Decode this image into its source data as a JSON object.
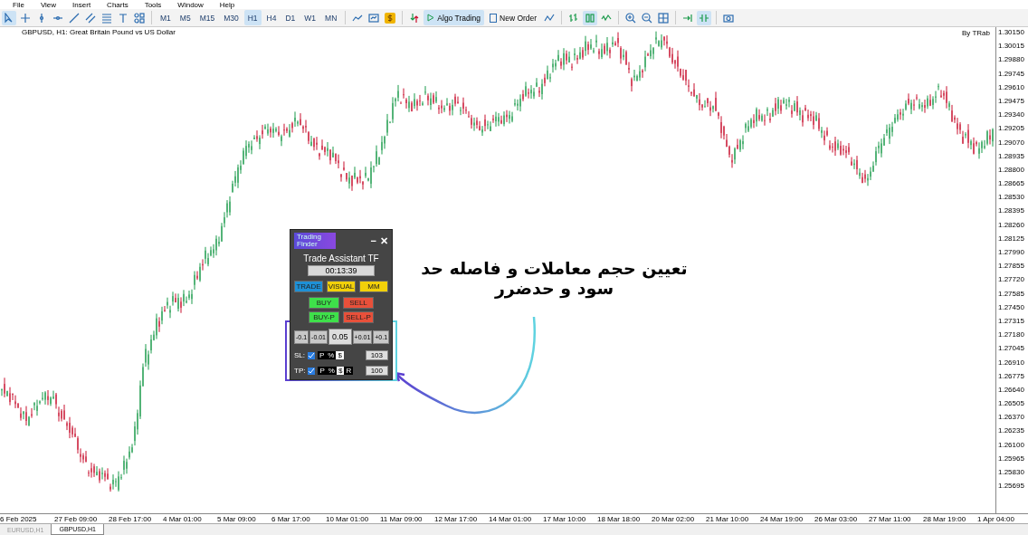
{
  "menu": [
    "File",
    "View",
    "Insert",
    "Charts",
    "Tools",
    "Window",
    "Help"
  ],
  "toolbar": {
    "timeframes": [
      {
        "label": "M1",
        "selected": false
      },
      {
        "label": "M5",
        "selected": false
      },
      {
        "label": "M15",
        "selected": false
      },
      {
        "label": "M30",
        "selected": false
      },
      {
        "label": "H1",
        "selected": true
      },
      {
        "label": "H4",
        "selected": false
      },
      {
        "label": "D1",
        "selected": false
      },
      {
        "label": "W1",
        "selected": false
      },
      {
        "label": "MN",
        "selected": false
      }
    ],
    "algo_trading": {
      "label": "Algo Trading",
      "selected": true
    },
    "new_order": {
      "label": "New Order"
    }
  },
  "chart": {
    "title": "GBPUSD, H1:  Great Britain Pound vs US Dollar",
    "author": "By TRab",
    "price_labels": [
      "1.30150",
      "1.30015",
      "1.29880",
      "1.29745",
      "1.29610",
      "1.29475",
      "1.29340",
      "1.29205",
      "1.29070",
      "1.28935",
      "1.28800",
      "1.28665",
      "1.28530",
      "1.28395",
      "1.28260",
      "1.28125",
      "1.27990",
      "1.27855",
      "1.27720",
      "1.27585",
      "1.27450",
      "1.27315",
      "1.27180",
      "1.27045",
      "1.26910",
      "1.26775",
      "1.26640",
      "1.26505",
      "1.26370",
      "1.26235",
      "1.26100",
      "1.25965",
      "1.25830",
      "1.25695"
    ],
    "time_labels": [
      "6 Feb 2025",
      "27 Feb 09:00",
      "28 Feb 17:00",
      "4 Mar 01:00",
      "5 Mar 09:00",
      "6 Mar 17:00",
      "10 Mar 01:00",
      "11 Mar 09:00",
      "12 Mar 17:00",
      "14 Mar 01:00",
      "17 Mar 10:00",
      "18 Mar 18:00",
      "20 Mar 02:00",
      "21 Mar 10:00",
      "24 Mar 19:00",
      "26 Mar 03:00",
      "27 Mar 11:00",
      "28 Mar 19:00",
      "1 Apr 04:00"
    ]
  },
  "panel": {
    "logo": "Trading Finder",
    "minimize": "−",
    "close": "✕",
    "title": "Trade Assistant TF",
    "timer": "00:13:39",
    "mode_buttons": [
      {
        "label": "TRADE",
        "color": "#1e90d6"
      },
      {
        "label": "VISUAL",
        "color": "#f2d00a"
      },
      {
        "label": "MM",
        "color": "#f2d00a"
      }
    ],
    "order_buttons": [
      {
        "label": "BUY",
        "color": "#3ee04a"
      },
      {
        "label": "SELL",
        "color": "#e8503a"
      },
      {
        "label": "BUY-P",
        "color": "#3ee04a"
      },
      {
        "label": "SELL-P",
        "color": "#e8503a"
      }
    ],
    "lot_steps": [
      "-0.1",
      "-0.01",
      "+0.01",
      "+0.1"
    ],
    "lot": "0.05",
    "rows": [
      {
        "label": "SL:",
        "checked": true,
        "units": [
          {
            "label": "P",
            "selected": false
          },
          {
            "label": "%",
            "selected": false
          },
          {
            "label": "$",
            "selected": true
          }
        ],
        "value": "103"
      },
      {
        "label": "TP:",
        "checked": true,
        "units": [
          {
            "label": "P",
            "selected": false
          },
          {
            "label": "%",
            "selected": false
          },
          {
            "label": "$",
            "selected": true
          },
          {
            "label": "R",
            "selected": false
          }
        ],
        "value": "100"
      }
    ]
  },
  "annotation": "تعیین حجم معاملات و فاصله حد سود و حدضرر",
  "tabs": [
    {
      "label": "EURUSD,H1",
      "selected": false
    },
    {
      "label": "GBPUSD,H1",
      "selected": true
    }
  ]
}
